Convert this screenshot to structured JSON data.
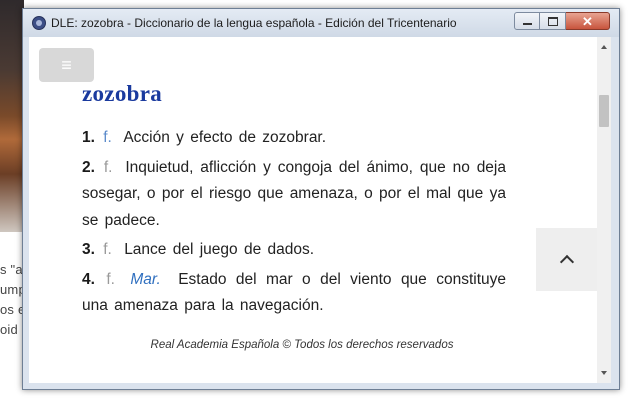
{
  "window": {
    "title": "DLE: zozobra - Diccionario de la lengua española - Edición del Tricentenario"
  },
  "background": {
    "text_lines": [
      "s \"ai",
      "ump",
      "os e",
      "oid"
    ]
  },
  "menu_button": {
    "icon": "hamburger-icon",
    "glyph": "≡"
  },
  "entry": {
    "word": "zozobra",
    "definitions": [
      {
        "num": "1.",
        "gram": "f.",
        "area": "",
        "text": "Acción y efecto de zozobrar."
      },
      {
        "num": "2.",
        "gram": "f.",
        "area": "",
        "text": "Inquietud, aflicción y congoja del ánimo, que no deja sosegar, o por el riesgo que amenaza, o por el mal que ya se padece."
      },
      {
        "num": "3.",
        "gram": "f.",
        "area": "",
        "text": "Lance del juego de dados."
      },
      {
        "num": "4.",
        "gram": "f.",
        "area": "Mar.",
        "text": "Estado del mar o del viento que constituye una amenaza para la navegación."
      }
    ]
  },
  "footer": "Real Academia Española © Todos los derechos reservados",
  "colors": {
    "headword": "#1a3a9e",
    "gram_first": "#5d8ccb",
    "gram_other": "#9a9a9a",
    "area": "#2f6fbf"
  }
}
